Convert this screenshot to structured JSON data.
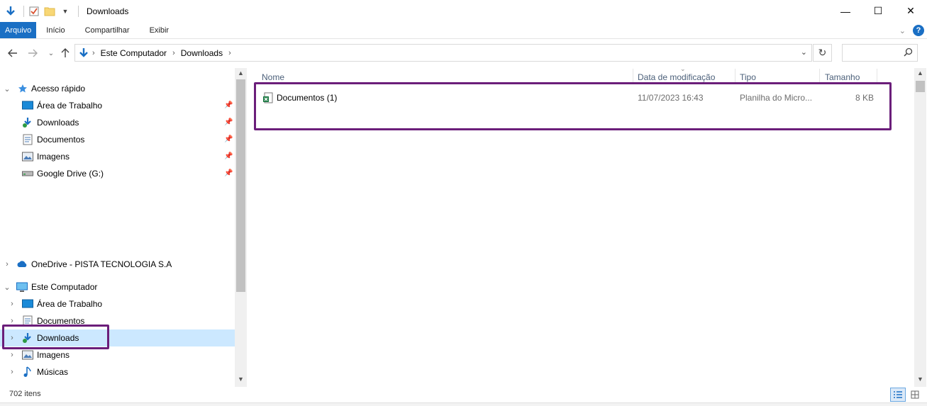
{
  "window": {
    "title": "Downloads",
    "controls": {
      "minimize": "—",
      "maximize": "☐",
      "close": "✕"
    }
  },
  "ribbon": {
    "tabs": [
      "Arquivo",
      "Início",
      "Compartilhar",
      "Exibir"
    ],
    "help": "?"
  },
  "address": {
    "crumbs": [
      "Este Computador",
      "Downloads"
    ],
    "search_placeholder": ""
  },
  "nav": {
    "quick_access": "Acesso rápido",
    "quick_items": [
      "Área de Trabalho",
      "Downloads",
      "Documentos",
      "Imagens",
      "Google Drive (G:)"
    ],
    "onedrive": "OneDrive - PISTA TECNOLOGIA S.A",
    "this_pc": "Este Computador",
    "pc_items": [
      "Área de Trabalho",
      "Documentos",
      "Downloads",
      "Imagens",
      "Músicas"
    ],
    "selected": "Downloads"
  },
  "columns": {
    "name": "Nome",
    "date": "Data de modificação",
    "type": "Tipo",
    "size": "Tamanho"
  },
  "files": [
    {
      "name": "Documentos (1)",
      "date": "11/07/2023 16:43",
      "type": "Planilha do Micro...",
      "size": "8 KB"
    }
  ],
  "status": {
    "count": "702 itens"
  },
  "colors": {
    "accent": "#1a6fc4",
    "highlight_border": "#6b1e7a",
    "selection": "#cce8ff"
  }
}
